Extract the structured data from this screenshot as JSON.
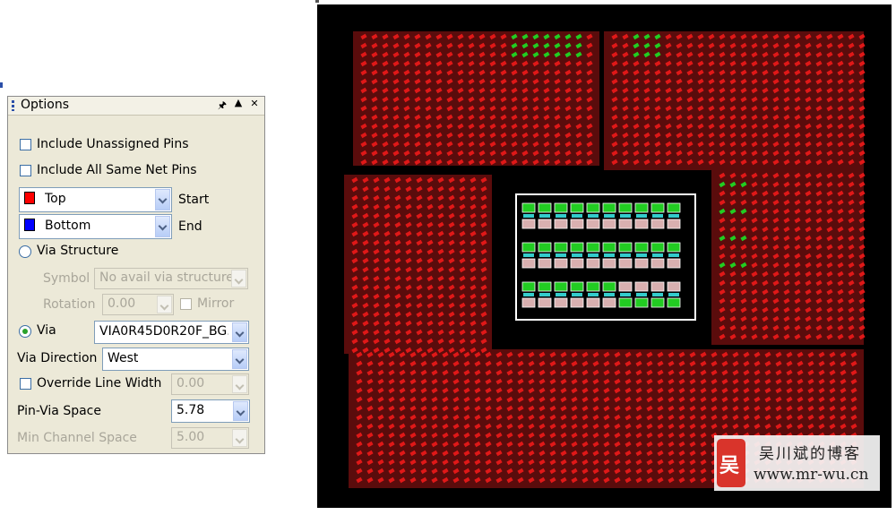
{
  "options_panel": {
    "title": "Options",
    "include_unassigned_pins": {
      "label": "Include Unassigned Pins",
      "checked": false
    },
    "include_all_same_net_pins": {
      "label": "Include All Same Net Pins",
      "checked": false
    },
    "start_layer": {
      "value": "Top",
      "color": "#ff0000",
      "side_label": "Start"
    },
    "end_layer": {
      "value": "Bottom",
      "color": "#0000ff",
      "side_label": "End"
    },
    "via_structure": {
      "label": "Via Structure",
      "selected": false
    },
    "symbol": {
      "label": "Symbol",
      "value": "No avail via structure"
    },
    "rotation": {
      "label": "Rotation",
      "value": "0.00"
    },
    "mirror": {
      "label": "Mirror",
      "checked": false
    },
    "via": {
      "label": "Via",
      "selected": true,
      "value": "VIA0R45D0R20F_BG."
    },
    "via_direction": {
      "label": "Via Direction",
      "value": "West"
    },
    "override_line_width": {
      "label": "Override Line Width",
      "checked": false,
      "value": "0.00"
    },
    "pin_via_space": {
      "label": "Pin-Via Space",
      "value": "5.78"
    },
    "min_channel_space": {
      "label": "Min Channel Space",
      "value": "5.00"
    }
  },
  "pcb_view": {
    "background": "#000000",
    "pad_color": "#e01818",
    "accent_green": "#22cc22",
    "component_pads": {
      "rows": 3,
      "per_row": 10
    }
  },
  "watermark": {
    "logo_char": "吴",
    "name": "吴川斌的博客",
    "url": "www.mr-wu.cn"
  }
}
